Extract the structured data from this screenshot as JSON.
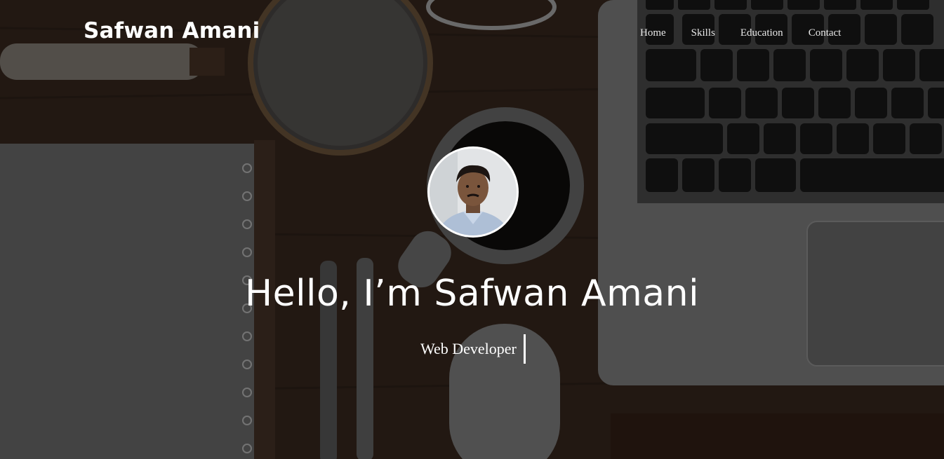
{
  "header": {
    "brand": "Safwan Amani",
    "nav": {
      "home": "Home",
      "skills": "Skills",
      "education": "Education",
      "contact": "Contact"
    }
  },
  "hero": {
    "greeting": "Hello, I’m Safwan Amani",
    "role": "Web Developer",
    "avatar_icon": "profile-photo"
  },
  "colors": {
    "text": "#ffffff",
    "background": "#2a1d15"
  }
}
